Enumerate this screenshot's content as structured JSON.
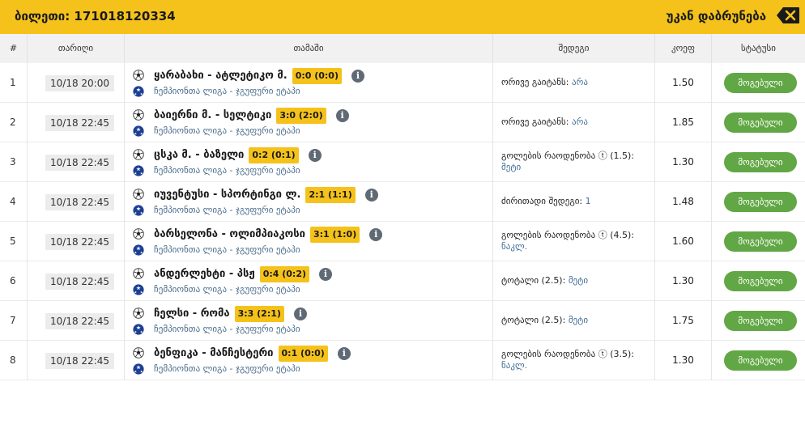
{
  "header": {
    "ticket_label": "ბილეთი: 171018120334",
    "back_label": "უკან დაბრუნება",
    "accent": "#f5c21b"
  },
  "columns": {
    "num": "#",
    "date": "თარიღი",
    "game": "თამაში",
    "result": "შედეგი",
    "coef": "კოეფ",
    "status": "სტატუსი"
  },
  "rows": [
    {
      "num": "1",
      "date": "10/18 20:00",
      "teams": "ყარაბახი - ატლეტიკო მ.",
      "score": "0:0 (0:0)",
      "league": "ჩემპიონთა ლიგა - ჯგუფური ეტაპი",
      "result_label": "ორივე გაიტანს:",
      "result_value": "არა",
      "coef": "1.50",
      "status": "მოგებული"
    },
    {
      "num": "2",
      "date": "10/18 22:45",
      "teams": "ბაიერნი მ. - სელტიკი",
      "score": "3:0 (2:0)",
      "league": "ჩემპიონთა ლიგა - ჯგუფური ეტაპი",
      "result_label": "ორივე გაიტანს:",
      "result_value": "არა",
      "coef": "1.85",
      "status": "მოგებული"
    },
    {
      "num": "3",
      "date": "10/18 22:45",
      "teams": "ცსკა მ. - ბაზელი",
      "score": "0:2 (0:1)",
      "league": "ჩემპიონთა ლიგა - ჯგუფური ეტაპი",
      "result_label": "გოლების რაოდენობა ⓣ (1.5):",
      "result_value": "მეტი",
      "coef": "1.30",
      "status": "მოგებული"
    },
    {
      "num": "4",
      "date": "10/18 22:45",
      "teams": "იუვენტუსი - სპორტინგი ლ.",
      "score": "2:1 (1:1)",
      "league": "ჩემპიონთა ლიგა - ჯგუფური ეტაპი",
      "result_label": "ძირითადი შედეგი:",
      "result_value": "1",
      "coef": "1.48",
      "status": "მოგებული"
    },
    {
      "num": "5",
      "date": "10/18 22:45",
      "teams": "ბარსელონა - ოლიმპიაკოსი",
      "score": "3:1 (1:0)",
      "league": "ჩემპიონთა ლიგა - ჯგუფური ეტაპი",
      "result_label": "გოლების რაოდენობა ⓣ (4.5):",
      "result_value": "ნაკლ.",
      "coef": "1.60",
      "status": "მოგებული"
    },
    {
      "num": "6",
      "date": "10/18 22:45",
      "teams": "ანდერლეხტი - პსჟ",
      "score": "0:4 (0:2)",
      "league": "ჩემპიონთა ლიგა - ჯგუფური ეტაპი",
      "result_label": "ტოტალი (2.5):",
      "result_value": "მეტი",
      "coef": "1.30",
      "status": "მოგებული"
    },
    {
      "num": "7",
      "date": "10/18 22:45",
      "teams": "ჩელსი - რომა",
      "score": "3:3 (2:1)",
      "league": "ჩემპიონთა ლიგა - ჯგუფური ეტაპი",
      "result_label": "ტოტალი (2.5):",
      "result_value": "მეტი",
      "coef": "1.75",
      "status": "მოგებული"
    },
    {
      "num": "8",
      "date": "10/18 22:45",
      "teams": "ბენფიკა - მანჩესტერი",
      "score": "0:1 (0:0)",
      "league": "ჩემპიონთა ლიგა - ჯგუფური ეტაპი",
      "result_label": "გოლების რაოდენობა ⓣ (3.5):",
      "result_value": "ნაკლ.",
      "coef": "1.30",
      "status": "მოგებული"
    }
  ],
  "icons": {
    "back": "backspace-icon",
    "sport": "soccer-ball-icon",
    "league": "champions-league-icon",
    "info": "info-icon"
  },
  "colors": {
    "status_won": "#62a745",
    "score_badge": "#f5c21b",
    "link": "#3f6d96"
  }
}
